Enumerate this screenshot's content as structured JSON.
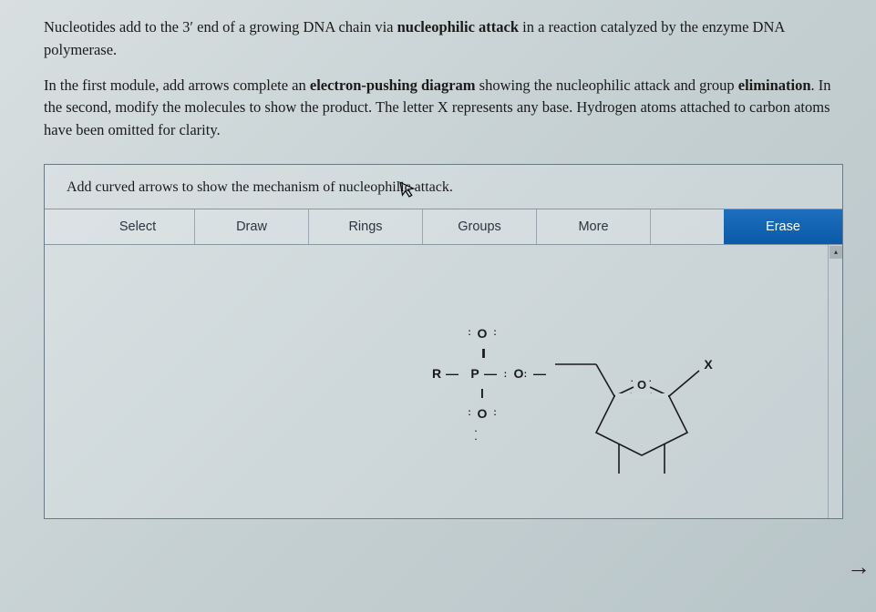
{
  "intro": {
    "p1_a": "Nucleotides add to the 3",
    "p1_prime": "′",
    "p1_b": " end of a growing DNA chain via ",
    "p1_bold1": "nucleophilic attack",
    "p1_c": " in a reaction catalyzed by the enzyme DNA polymerase.",
    "p2_a": "In the first module, add arrows complete an ",
    "p2_bold1": "electron-pushing diagram",
    "p2_b": " showing the nucleophilic attack and group ",
    "p2_bold2": "elimination",
    "p2_c": ". In the second, modify the molecules to show the product. The letter X represents any base. Hydrogen atoms attached to carbon atoms have been omitted for clarity."
  },
  "module": {
    "instruction": "Add curved arrows to show the mechanism of nucleophilic attack."
  },
  "toolbar": {
    "select": "Select",
    "draw": "Draw",
    "rings": "Rings",
    "groups": "Groups",
    "more": "More",
    "erase": "Erase"
  },
  "molecule": {
    "R": "R",
    "P": "P",
    "O_top": "O",
    "O_right": "O",
    "O_bottom": "O",
    "O_ring": "O",
    "X": "X",
    "dbond": "ll",
    "sbond_v": "l",
    "sbond_h": "—",
    "lone_h": ":",
    "lone_dot": "."
  },
  "icons": {
    "cursor": "cursor-icon",
    "next_arrow": "→",
    "scroll_up": "▴"
  }
}
